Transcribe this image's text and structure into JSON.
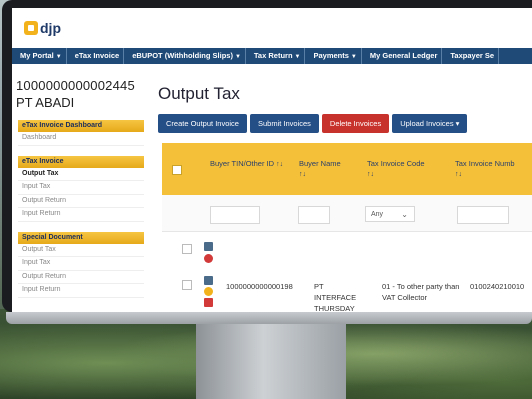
{
  "app": {
    "logo_text": "djp"
  },
  "nav": {
    "items": [
      "My Portal",
      "eTax Invoice",
      "eBUPOT (Withholding Slips)",
      "Tax Return",
      "Payments",
      "My General Ledger",
      "Taxpayer Se"
    ],
    "has_caret": [
      true,
      false,
      true,
      true,
      true,
      false,
      false
    ]
  },
  "account": {
    "id": "1000000000002445",
    "name": "PT ABADI"
  },
  "sidebar": {
    "sections": [
      {
        "title": "eTax Invoice Dashboard",
        "items": [
          "Dashboard"
        ]
      },
      {
        "title": "eTax Invoice",
        "items": [
          "Output Tax",
          "Input Tax",
          "Output Return",
          "Input Return"
        ],
        "active": "Output Tax"
      },
      {
        "title": "Special Document",
        "items": [
          "Output Tax",
          "Input Tax",
          "Output Return",
          "Input Return"
        ]
      }
    ]
  },
  "main": {
    "title": "Output Tax",
    "buttons": {
      "create": "Create Output Invoice",
      "submit": "Submit Invoices",
      "delete": "Delete Invoices",
      "upload": "Upload Invoices"
    },
    "columns": {
      "buyer_tin": "Buyer TIN/Other ID",
      "buyer_name": "Buyer Name",
      "tax_invoice_code": "Tax Invoice Code",
      "tax_invoice_number": "Tax Invoice Numb"
    },
    "sort_glyph": "↑↓",
    "filter_select": "Any",
    "rows": [
      {
        "buyer_tin": "",
        "buyer_name": "",
        "code": "",
        "number": ""
      },
      {
        "buyer_tin": "1000000000000198",
        "buyer_name": "PT INTERFACE THURSDAY",
        "code": "01 - To other party than VAT Collector",
        "number": "0100240210010"
      }
    ]
  },
  "colors": {
    "nav": "#1f4a78",
    "header": "#f4c03a",
    "primary": "#234e86",
    "danger": "#c8322d"
  }
}
